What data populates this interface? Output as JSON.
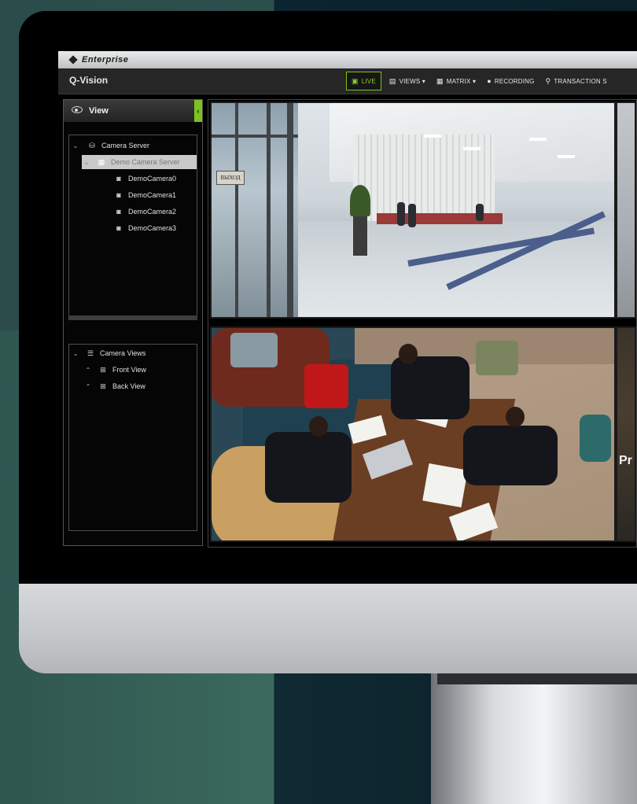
{
  "brand": {
    "logo_text": "Enterprise"
  },
  "app": {
    "title": "Q-Vision"
  },
  "nav": {
    "items": [
      {
        "label": "LIVE",
        "icon": "live-icon",
        "active": true
      },
      {
        "label": "VIEWS ▾",
        "icon": "views-icon",
        "active": false
      },
      {
        "label": "MATRIX ▾",
        "icon": "grid-icon",
        "active": false
      },
      {
        "label": "RECORDING",
        "icon": "record-dot-icon",
        "active": false
      },
      {
        "label": "TRANSACTION S",
        "icon": "search-icon",
        "active": false
      }
    ],
    "accent_color": "#7cc11f"
  },
  "sidebar": {
    "header_title": "View",
    "collapse_glyph": "‹",
    "server_tree": {
      "root_label": "Camera Server",
      "server_label": "Demo Camera Server",
      "cameras": [
        "DemoCamera0",
        "DemoCamera1",
        "DemoCamera2",
        "DemoCamera3"
      ]
    },
    "views_tree": {
      "root_label": "Camera Views",
      "views": [
        "Front View",
        "Back View"
      ]
    }
  },
  "video": {
    "lobby_sign": "ВЫХОД",
    "tile4_text": "Pr"
  }
}
